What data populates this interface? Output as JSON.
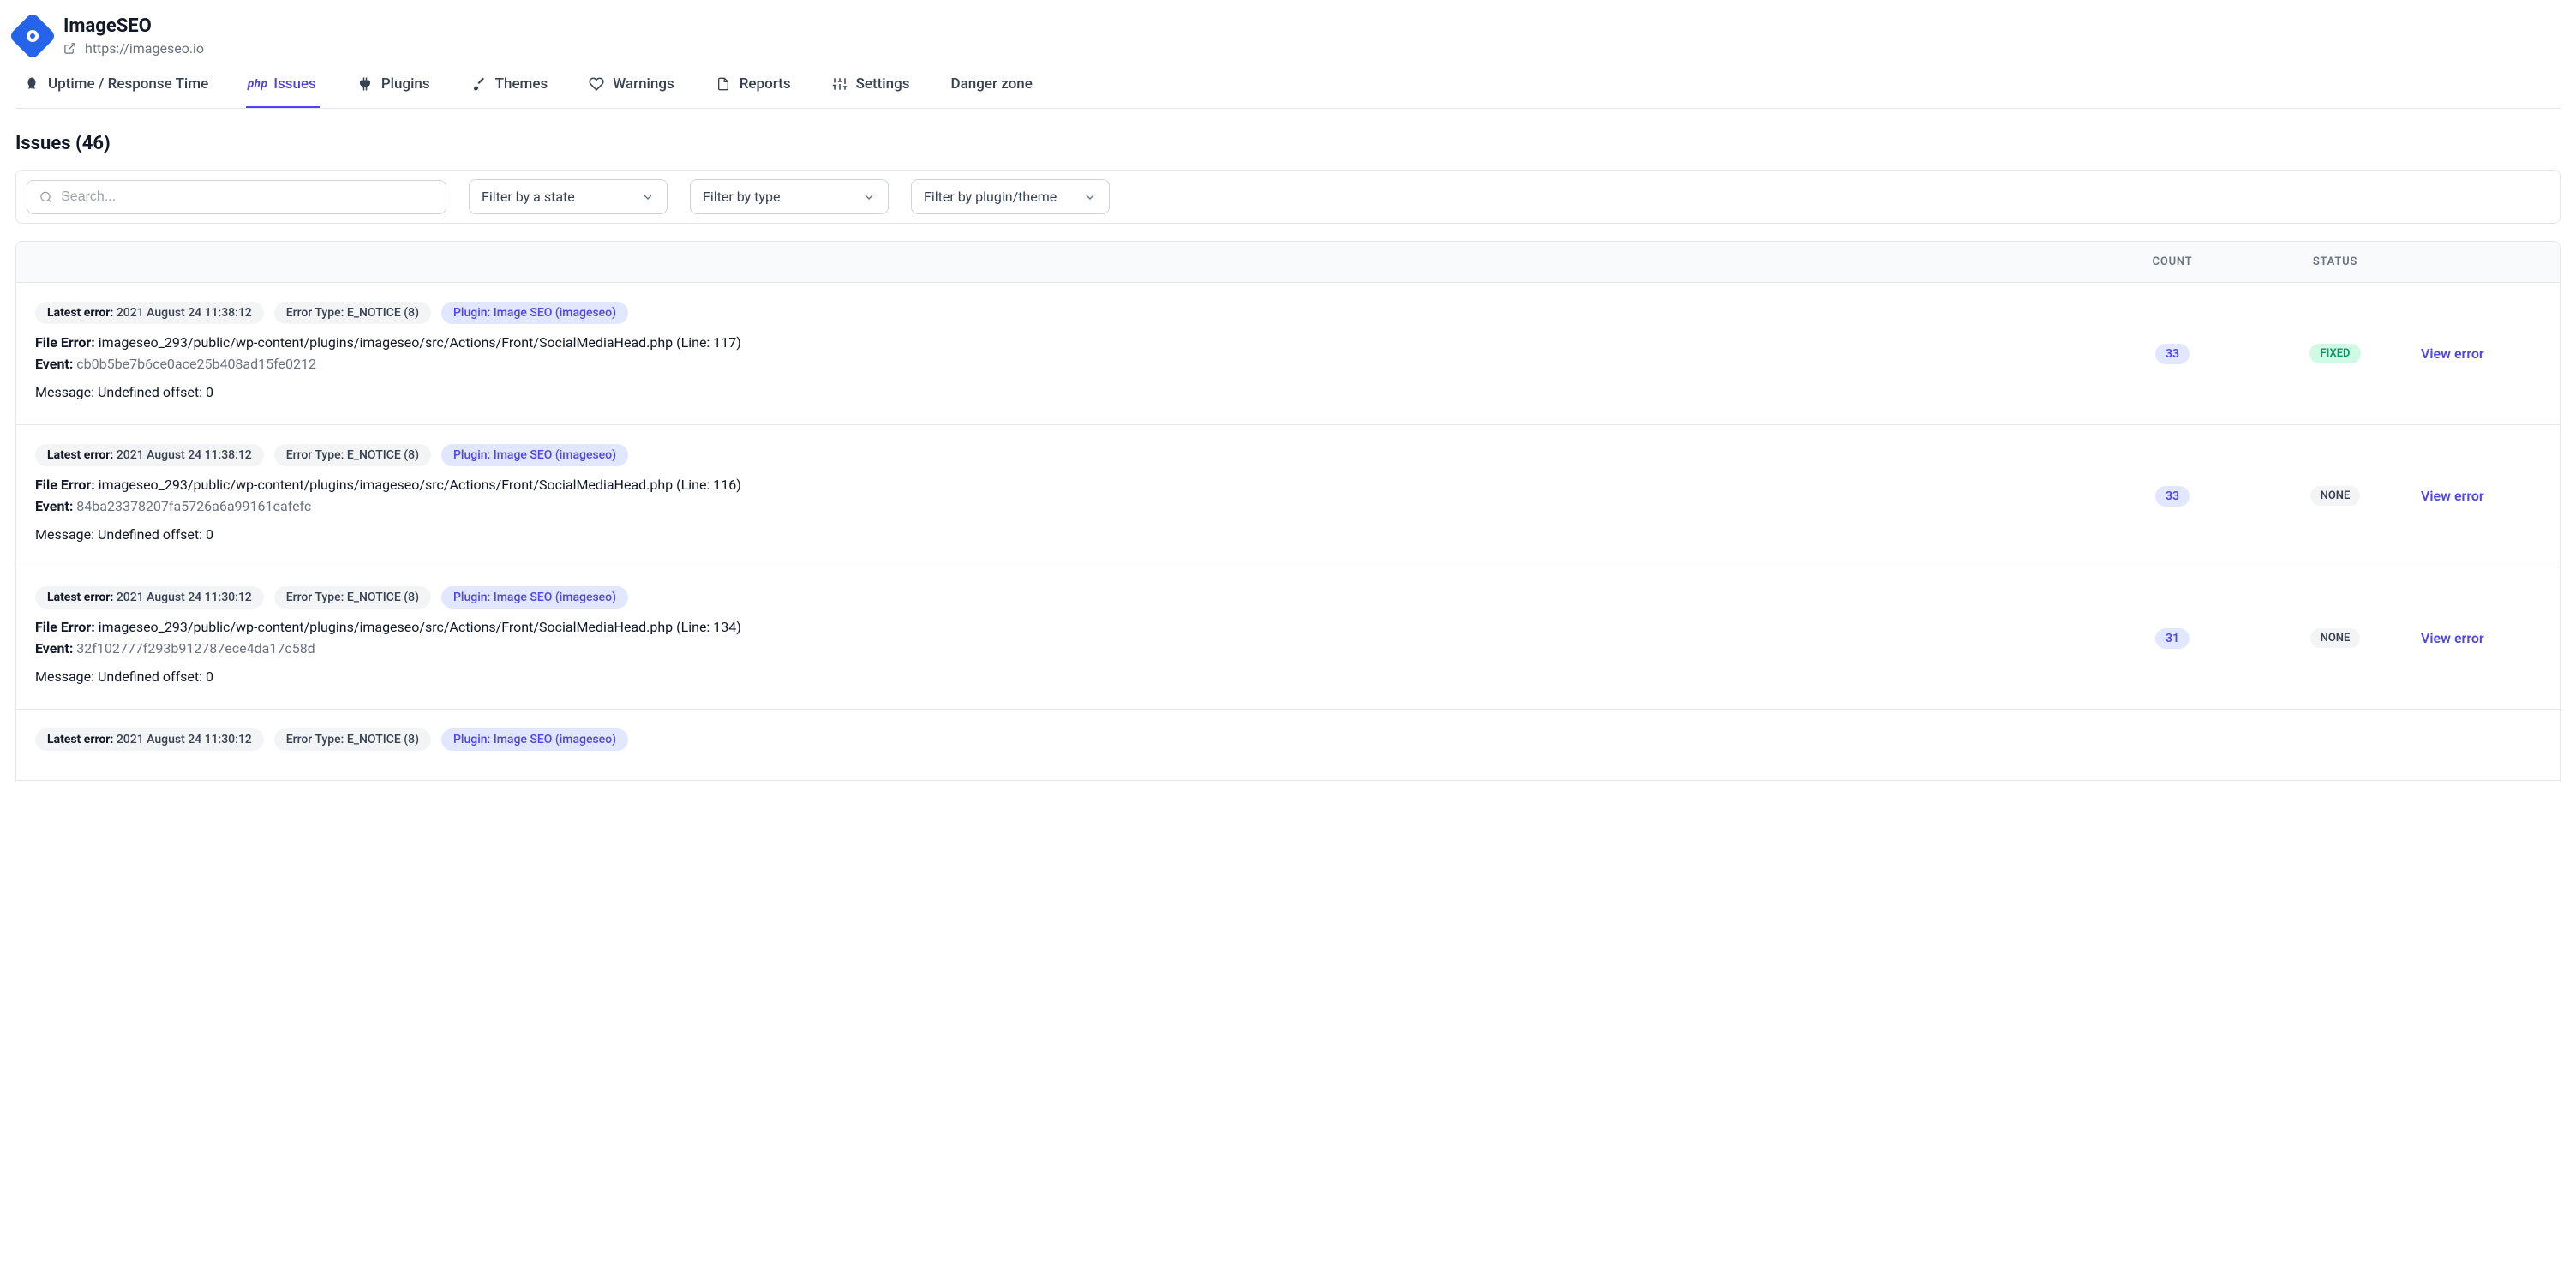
{
  "header": {
    "title": "ImageSEO",
    "url": "https://imageseo.io"
  },
  "tabs": [
    {
      "label": "Uptime / Response Time",
      "icon": "rocket"
    },
    {
      "label": "Issues",
      "icon": "php",
      "active": true
    },
    {
      "label": "Plugins",
      "icon": "plug"
    },
    {
      "label": "Themes",
      "icon": "brush"
    },
    {
      "label": "Warnings",
      "icon": "heart"
    },
    {
      "label": "Reports",
      "icon": "doc"
    },
    {
      "label": "Settings",
      "icon": "sliders"
    },
    {
      "label": "Danger zone",
      "icon": "none"
    }
  ],
  "page": {
    "heading": "Issues (46)"
  },
  "filters": {
    "search_placeholder": "Search...",
    "state_label": "Filter by a state",
    "type_label": "Filter by type",
    "plugin_label": "Filter by plugin/theme"
  },
  "table": {
    "count_header": "COUNT",
    "status_header": "STATUS",
    "view_label": "View error",
    "latest_error_label": "Latest error:",
    "error_type_label": "Error Type:",
    "plugin_prefix": "Plugin:",
    "file_error_label": "File Error:",
    "event_label": "Event:",
    "message_label": "Message:"
  },
  "issues": [
    {
      "latest_error": "2021 August 24 11:38:12",
      "error_type": "E_NOTICE (8)",
      "plugin": "Image SEO (imageseo)",
      "file_error": "imageseo_293/public/wp-content/plugins/imageseo/src/Actions/Front/SocialMediaHead.php (Line: 117)",
      "event": "cb0b5be7b6ce0ace25b408ad15fe0212",
      "message": "Undefined offset: 0",
      "count": "33",
      "status": "FIXED"
    },
    {
      "latest_error": "2021 August 24 11:38:12",
      "error_type": "E_NOTICE (8)",
      "plugin": "Image SEO (imageseo)",
      "file_error": "imageseo_293/public/wp-content/plugins/imageseo/src/Actions/Front/SocialMediaHead.php (Line: 116)",
      "event": "84ba23378207fa5726a6a99161eafefc",
      "message": "Undefined offset: 0",
      "count": "33",
      "status": "NONE"
    },
    {
      "latest_error": "2021 August 24 11:30:12",
      "error_type": "E_NOTICE (8)",
      "plugin": "Image SEO (imageseo)",
      "file_error": "imageseo_293/public/wp-content/plugins/imageseo/src/Actions/Front/SocialMediaHead.php (Line: 134)",
      "event": "32f102777f293b912787ece4da17c58d",
      "message": "Undefined offset: 0",
      "count": "31",
      "status": "NONE"
    },
    {
      "latest_error": "2021 August 24 11:30:12",
      "error_type": "E_NOTICE (8)",
      "plugin": "Image SEO (imageseo)",
      "file_error": "",
      "event": "",
      "message": "",
      "count": "",
      "status": ""
    }
  ]
}
